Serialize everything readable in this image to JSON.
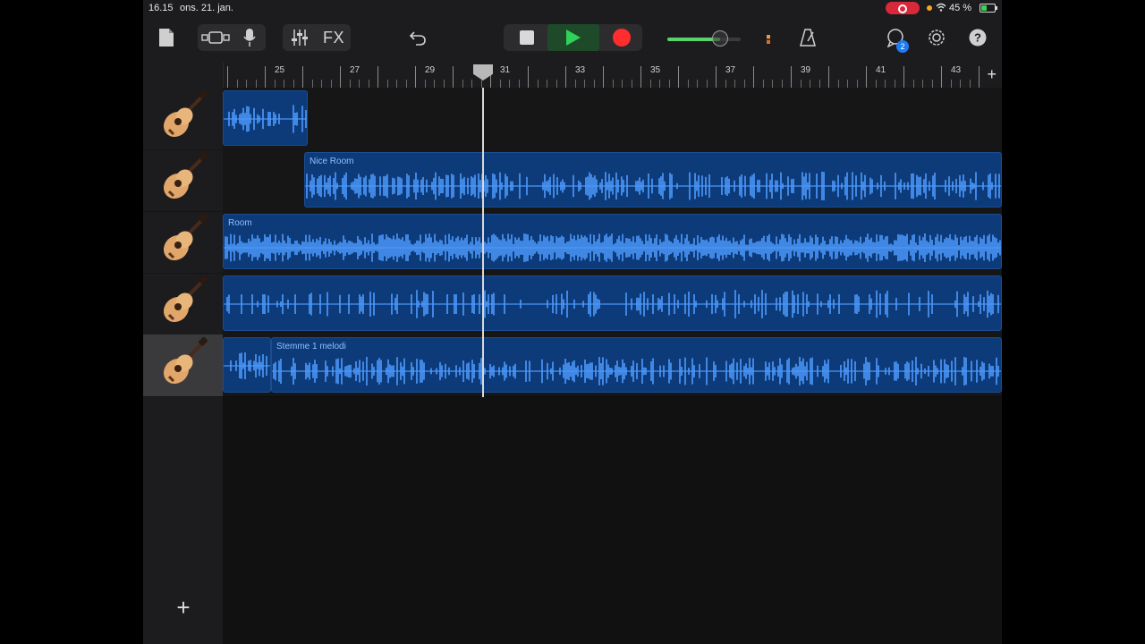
{
  "status": {
    "time": "16.15",
    "date": "ons. 21. jan.",
    "battery": "45 %",
    "battery_level": 0.45
  },
  "toolbar": {
    "fx_label": "FX",
    "notifications_count": "2",
    "volume_level": 0.72,
    "colors": {
      "play": "#2fd158",
      "record": "#ff2d2d",
      "volume": "#57d36b",
      "badge": "#1e7cf2"
    }
  },
  "ruler": {
    "bars": [
      "25",
      "27",
      "29",
      "31",
      "33",
      "35",
      "37",
      "39",
      "41",
      "43"
    ]
  },
  "tracks": [
    {
      "instrument": "acoustic-guitar",
      "regions": [
        {
          "name": ""
        }
      ]
    },
    {
      "instrument": "acoustic-guitar",
      "regions": [
        {
          "name": "Nice Room"
        }
      ]
    },
    {
      "instrument": "acoustic-guitar",
      "regions": [
        {
          "name": "Room"
        }
      ]
    },
    {
      "instrument": "acoustic-guitar",
      "regions": [
        {
          "name": ""
        }
      ]
    },
    {
      "instrument": "acoustic-guitar",
      "selected": true,
      "regions": [
        {
          "name": ""
        },
        {
          "name": "Stemme 1 melodi"
        }
      ]
    }
  ],
  "colors": {
    "region_fill": "#0d3a78",
    "waveform": "#4d9bff",
    "region_label": "#8fc0ff"
  }
}
